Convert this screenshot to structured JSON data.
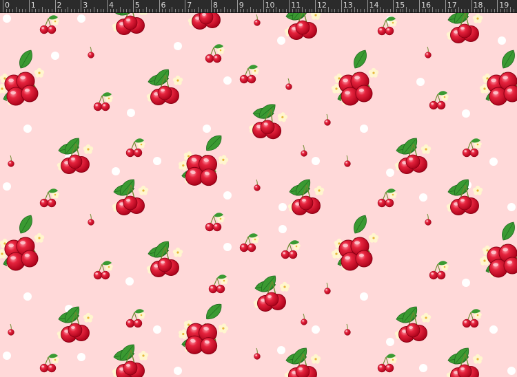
{
  "ruler": {
    "labels": [
      "0",
      "1",
      "2",
      "3",
      "4",
      "5",
      "6",
      "7",
      "8",
      "9",
      "10",
      "11",
      "12",
      "13",
      "14",
      "15",
      "16",
      "17",
      "18",
      "19"
    ]
  },
  "canvas": {
    "pattern": "cherry-fabric",
    "colors": {
      "background": "#ffd9d9",
      "dot": "#ffffff",
      "cherry": "#d3102a",
      "cherry_shine": "#f47f90",
      "leaf": "#2e8b2e",
      "blossom": "#fff3c0",
      "stem": "#7a9a3a"
    }
  }
}
